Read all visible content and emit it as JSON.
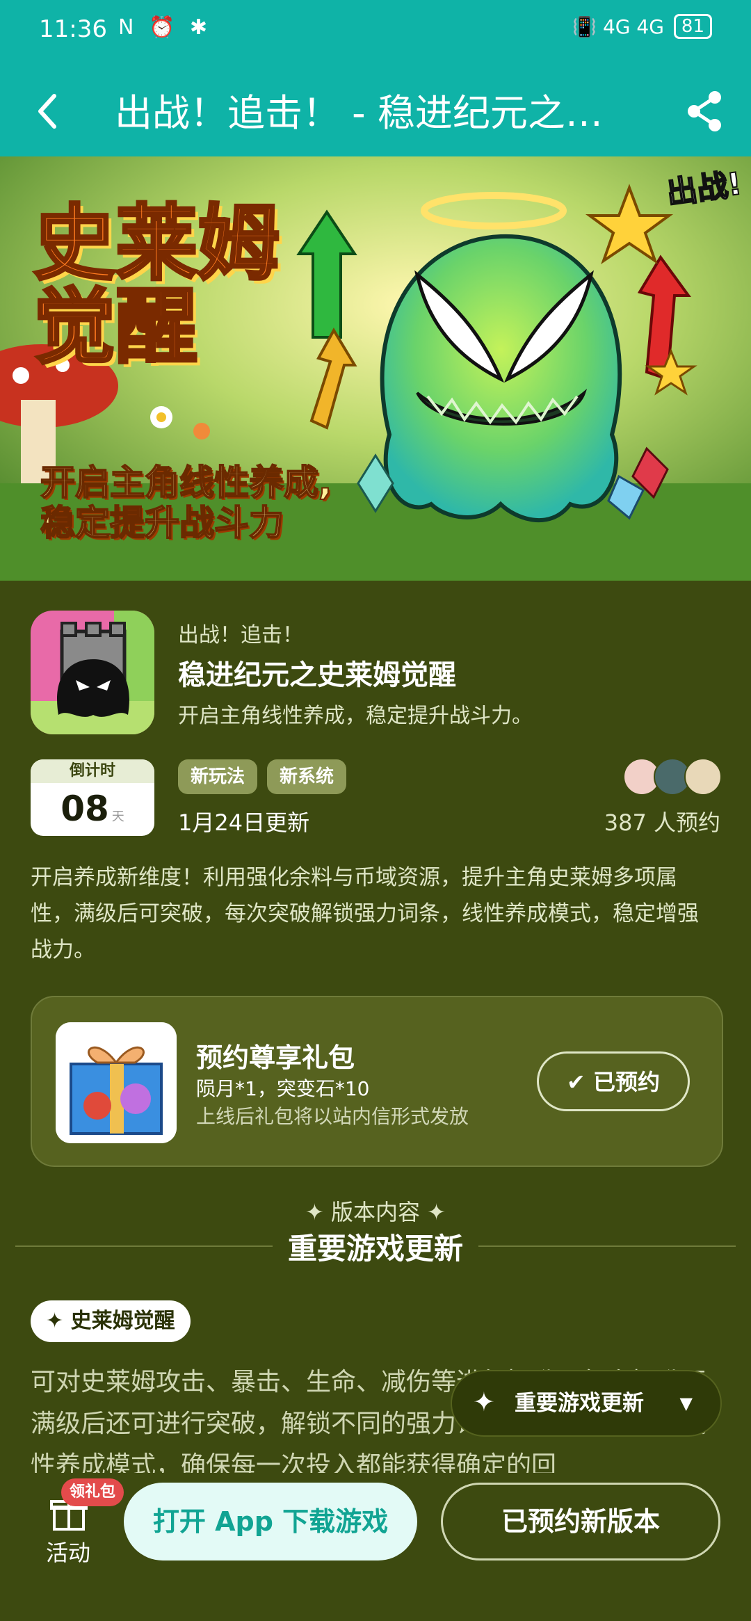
{
  "status_bar": {
    "time": "11:36",
    "battery": "81",
    "left_icons": "N ⏰ ✱",
    "right_icons": "📳 4G 4G"
  },
  "header": {
    "title": "出战！追击！ - 稳进纪元之…"
  },
  "banner": {
    "title": "史莱姆觉醒",
    "subtitle_line1": "开启主角线性养成,",
    "subtitle_line2": "稳定提升战斗力",
    "logo_text": "出战!"
  },
  "game": {
    "small_title": "出战！追击！",
    "name": "稳进纪元之史莱姆觉醒",
    "desc": "开启主角线性养成，稳定提升战斗力。"
  },
  "countdown": {
    "label": "倒计时",
    "value": "08",
    "unit": "天"
  },
  "tags": [
    "新玩法",
    "新系统"
  ],
  "update_date": "1月24日更新",
  "reserve_count": "387 人预约",
  "intro": "开启养成新维度！利用强化余料与币域资源，提升主角史莱姆多项属性，满级后可突破，每次突破解锁强力词条，线性养成模式，稳定增强战力。",
  "gift": {
    "title": "预约尊享礼包",
    "items": "陨月*1，突变石*10",
    "note": "上线后礼包将以站内信形式发放",
    "button": "已预约"
  },
  "version": {
    "label": "✦ 版本内容 ✦",
    "section_title": "重要游戏更新"
  },
  "feature": {
    "chip": "✦ 史莱姆觉醒",
    "text": "可对史莱姆攻击、暴击、生命、减伤等进行提升，每次提升至满级后还可进行突破，解锁不同的强力词条。养成方法采用线性养成模式，确保每一次投入都能获得确定的回"
  },
  "floating_pill": {
    "label": "重要游戏更新",
    "star": "✦",
    "arrow": "▼"
  },
  "bottom": {
    "badge": "领礼包",
    "activity": "活动",
    "open_app": "打开 App 下载游戏",
    "reserved_version": "已预约新版本"
  },
  "colors": {
    "teal": "#0fb3a7",
    "bg": "#3d4a10",
    "accent_text": "#11a493"
  }
}
